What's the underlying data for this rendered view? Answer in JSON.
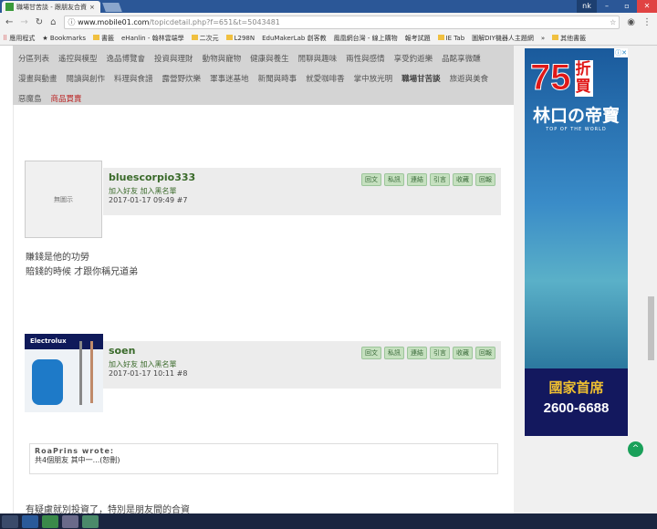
{
  "browser": {
    "tab_title": "職場甘苦談 - 跟朋友合資",
    "user": "nk",
    "url_host": "www.mobile01.com",
    "url_path": "/topicdetail.php?f=651&t=5043481",
    "bookmarks": [
      "應用程式",
      "Bookmarks",
      "書籤",
      "eHanlin - 翰林雲端學",
      "二次元",
      "L298N",
      "EduMakerLab 創客教",
      "鳳凰網台灣 - 線上購物",
      "報考試題",
      "IE Tab",
      "圖解DIY機器人主題網",
      "»",
      "其他書籤"
    ]
  },
  "nav": {
    "items": [
      "分區列表",
      "遙控與模型",
      "逸品博覽會",
      "投資與理財",
      "動物與寵物",
      "健康與養生",
      "閒聊與趣味",
      "兩性與感情",
      "享受釣遊樂",
      "品酩享微醺",
      "漫畫與動畫",
      "閱讀與創作",
      "料理與食譜",
      "露營野炊樂",
      "軍事迷基地",
      "新聞與時事",
      "就愛咖啡香",
      "掌中放光明",
      "職場甘苦談",
      "旅遊與美食",
      "惡魔島",
      "商品買賣"
    ]
  },
  "posts": [
    {
      "username": "bluescorpio333",
      "avatar_text": "無圖示",
      "add_friend": "加入好友",
      "add_block": "加入黑名單",
      "date": "2017-01-17 09:49",
      "floor": "#7",
      "body": [
        "賺錢是他的功勞",
        "賠錢的時候 才跟你稱兄道弟"
      ]
    },
    {
      "username": "soen",
      "avatar_brand": "Electrolux",
      "add_friend": "加入好友",
      "add_block": "加入黑名單",
      "date": "2017-01-17 10:11",
      "floor": "#8",
      "quote_author": "RoaPrins wrote:",
      "quote_text": "共4個朋友 其中一...(恕刪)",
      "body": [
        "有疑慮就別投資了，特別是朋友間的合資"
      ]
    }
  ],
  "post_buttons": [
    "回文",
    "私訊",
    "連結",
    "引言",
    "收藏",
    "回報"
  ],
  "ad": {
    "discount": "75",
    "discount_unit": "折買",
    "name": "林口の帝寶",
    "tagline": "TOP OF THE WORLD",
    "slogan": "國家首席",
    "phone": "2600-6688",
    "close": "ⓘ✕"
  }
}
